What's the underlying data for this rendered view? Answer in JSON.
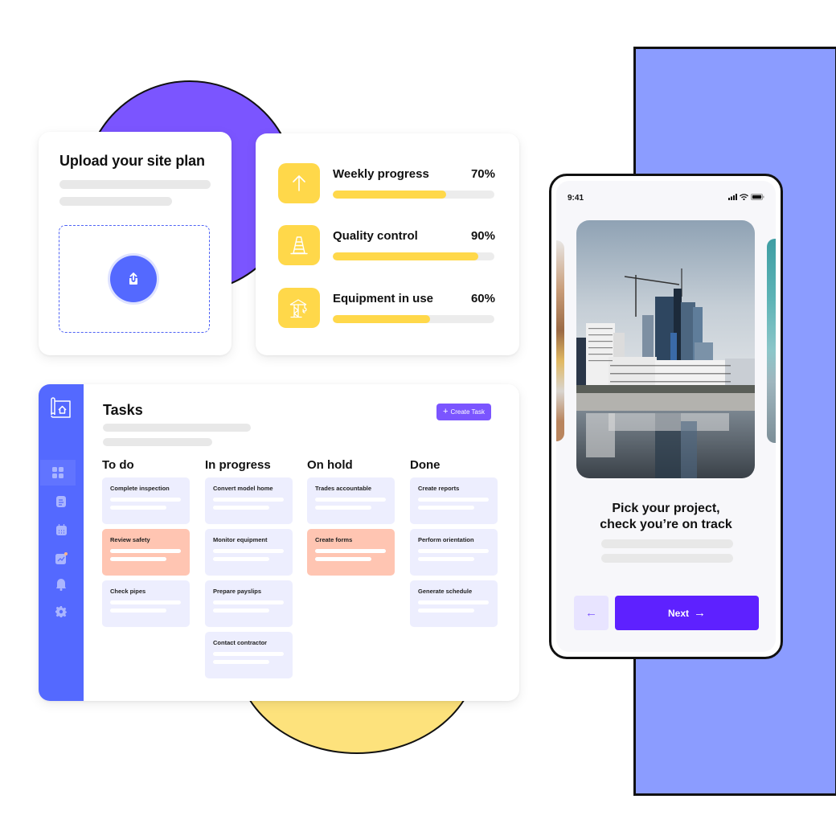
{
  "upload_card": {
    "title": "Upload your site plan",
    "upload_icon": "upload-icon"
  },
  "progress_card": {
    "items": [
      {
        "label": "Weekly progress",
        "value_text": "70%",
        "value": 70,
        "icon": "arrow-up-icon"
      },
      {
        "label": "Quality control",
        "value_text": "90%",
        "value": 90,
        "icon": "traffic-cone-icon"
      },
      {
        "label": "Equipment in use",
        "value_text": "60%",
        "value": 60,
        "icon": "crane-icon"
      }
    ]
  },
  "tasks_card": {
    "title": "Tasks",
    "create_button": {
      "icon": "+",
      "label": "Create Task"
    },
    "sidebar": {
      "logo": "blueprint-home-icon",
      "items": [
        {
          "icon": "grid-icon",
          "active": true
        },
        {
          "icon": "document-icon",
          "active": false
        },
        {
          "icon": "calendar-icon",
          "active": false
        },
        {
          "icon": "chart-icon",
          "active": false
        },
        {
          "icon": "bell-icon",
          "active": false
        },
        {
          "icon": "gear-icon",
          "active": false
        }
      ]
    },
    "columns": [
      {
        "title": "To do",
        "tasks": [
          {
            "label": "Complete inspection",
            "highlight": false
          },
          {
            "label": "Review safety",
            "highlight": true
          },
          {
            "label": "Check pipes",
            "highlight": false
          }
        ]
      },
      {
        "title": "In progress",
        "tasks": [
          {
            "label": "Convert model home",
            "highlight": false
          },
          {
            "label": "Monitor equipment",
            "highlight": false
          },
          {
            "label": "Prepare payslips",
            "highlight": false
          },
          {
            "label": "Contact contractor",
            "highlight": false
          }
        ]
      },
      {
        "title": "On hold",
        "tasks": [
          {
            "label": "Trades accountable",
            "highlight": false
          },
          {
            "label": "Create forms",
            "highlight": true
          }
        ]
      },
      {
        "title": "Done",
        "tasks": [
          {
            "label": "Create reports",
            "highlight": false
          },
          {
            "label": "Perform orientation",
            "highlight": false
          },
          {
            "label": "Generate schedule",
            "highlight": false
          }
        ]
      }
    ]
  },
  "phone": {
    "status_time": "9:41",
    "heading_line1": "Pick your project,",
    "heading_line2": "check you’re on track",
    "back_label": "←",
    "next_label": "Next",
    "next_arrow": "→"
  },
  "colors": {
    "accent_purple": "#7b55ff",
    "primary_blue": "#5469ff",
    "next_button": "#5e21ff",
    "progress_yellow": "#ffd84a",
    "highlight_task": "#ffc5b2",
    "task_bg": "#edeefe",
    "bg_blue_rect": "#8b9cff",
    "bg_yellow_circle": "#fde27c"
  }
}
